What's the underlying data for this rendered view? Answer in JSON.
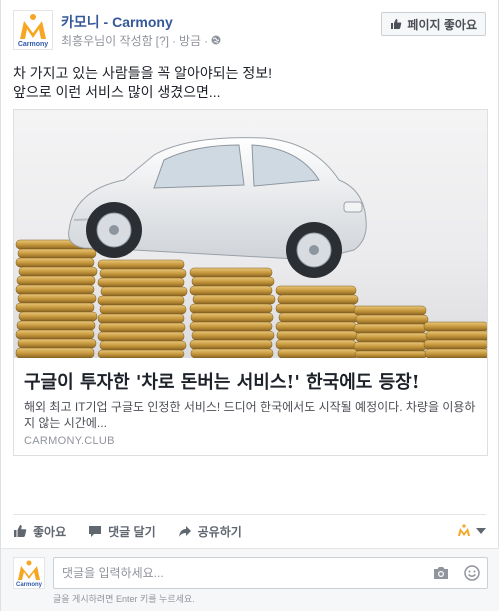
{
  "header": {
    "page_name": "카모니 - Carmony",
    "author": "최흥우님이 작성함",
    "help_marker": "[?]",
    "sep1": "·",
    "time": "방금",
    "sep2": "·",
    "privacy_icon": "globe-icon",
    "like_page_label": "페이지 좋아요",
    "logo_text": "Carmony"
  },
  "post": {
    "line1": "차 가지고 있는 사람들을 꼭 알아야되는 정보!",
    "line2": "앞으로 이런 서비스 많이 생겼으면..."
  },
  "card": {
    "title": "구글이 투자한 '차로 돈버는 서비스!' 한국에도 등장!",
    "description": "해외 최고 IT기업 구글도 인정한 서비스! 드디어 한국에서도 시작될 예정이다. 차량을 이용하지 않는 시간에...",
    "domain": "CARMONY.CLUB",
    "image_subject": "white car on stacks of coins"
  },
  "actions": {
    "like": "좋아요",
    "comment": "댓글 달기",
    "share": "공유하기"
  },
  "comment": {
    "placeholder": "댓글을 입력하세요...",
    "hint": "글을 게시하려면 Enter 키를 누르세요."
  },
  "colors": {
    "link_blue": "#365899",
    "brand_orange": "#f5a623",
    "brand_blue": "#2f5aa8"
  }
}
